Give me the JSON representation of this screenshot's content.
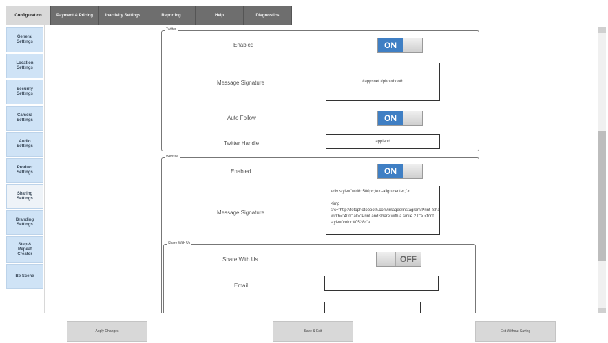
{
  "tabs": [
    {
      "label": "Configuration",
      "active": true
    },
    {
      "label": "Payment & Pricing",
      "active": false
    },
    {
      "label": "Inactivity Settings",
      "active": false
    },
    {
      "label": "Reporting",
      "active": false
    },
    {
      "label": "Help",
      "active": false
    },
    {
      "label": "Diagnostics",
      "active": false
    }
  ],
  "sidebar": {
    "items": [
      {
        "label": "General\nSettings"
      },
      {
        "label": "Location\nSettings"
      },
      {
        "label": "Security\nSettings"
      },
      {
        "label": "Camera\nSettings"
      },
      {
        "label": "Audio\nSettings"
      },
      {
        "label": "Product\nSettings"
      },
      {
        "label": "Sharing\nSettings"
      },
      {
        "label": "Branding\nSettings"
      },
      {
        "label": "Step &\nRepeat\nCreator"
      },
      {
        "label": "Be Scene"
      }
    ]
  },
  "twitter": {
    "legend": "Twitter",
    "enabled_label": "Enabled",
    "enabled_state": "ON",
    "signature_label": "Message Signature",
    "signature_value": "#appsnet #photobooth",
    "autofollow_label": "Auto Follow",
    "autofollow_state": "ON",
    "handle_label": "Twitter Handle",
    "handle_value": "appland"
  },
  "website": {
    "legend": "Website",
    "enabled_label": "Enabled",
    "enabled_state": "ON",
    "signature_label": "Message Signature",
    "signature_value": "<div style=\"width:500px;text-align:center;\">\n\n<img src=\"http://fotophotobooth.com/images/instagram/Print_Share_Smile7C.jpg\" width=\"400\" alt=\"Print and share with a smile 2.0\"> <font style=\"color:#0528c\">"
  },
  "share": {
    "legend": "Share With Us",
    "share_label": "Share With Us",
    "share_state": "OFF",
    "email_label": "Email",
    "email_value": ""
  },
  "buttons": {
    "apply": "Apply Changes",
    "save": "Save & Exit",
    "cancel": "Exit Without Saving"
  }
}
